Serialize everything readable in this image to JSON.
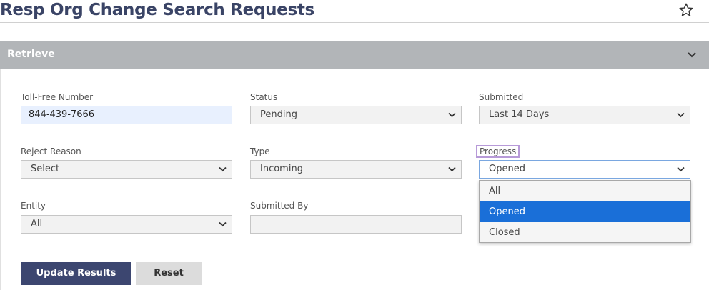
{
  "page": {
    "title": "Resp Org Change Search Requests"
  },
  "panel": {
    "title": "Retrieve"
  },
  "form": {
    "toll_free_number": {
      "label": "Toll-Free Number",
      "value": "844-439-7666"
    },
    "status": {
      "label": "Status",
      "value": "Pending"
    },
    "submitted": {
      "label": "Submitted",
      "value": "Last 14 Days"
    },
    "reject_reason": {
      "label": "Reject Reason",
      "value": "Select"
    },
    "type": {
      "label": "Type",
      "value": "Incoming"
    },
    "progress": {
      "label": "Progress",
      "value": "Opened",
      "options": [
        "All",
        "Opened",
        "Closed"
      ],
      "selected_index": 1
    },
    "entity": {
      "label": "Entity",
      "value": "All"
    },
    "submitted_by": {
      "label": "Submitted By",
      "value": ""
    }
  },
  "buttons": {
    "update": "Update Results",
    "reset": "Reset"
  },
  "colors": {
    "title": "#3a4466",
    "panel_header": "#b2b5b8",
    "selected_option": "#1a6fd8",
    "primary_button": "#3c4670",
    "focus_outline": "#b79ad8"
  }
}
